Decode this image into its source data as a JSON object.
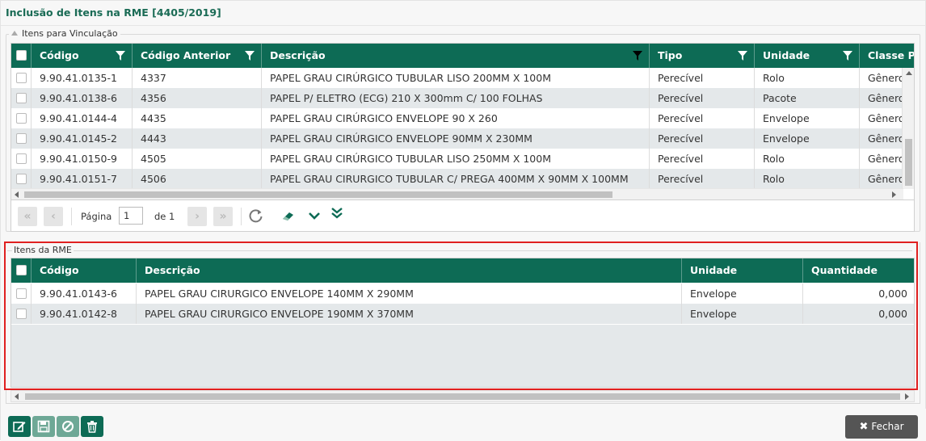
{
  "window": {
    "title": "Inclusão de Itens na RME [4405/2019]"
  },
  "vinculacao": {
    "legend": "Itens para Vinculação",
    "columns": [
      "Código",
      "Código Anterior",
      "Descrição",
      "Tipo",
      "Unidade",
      "Classe Pa"
    ],
    "rows": [
      {
        "codigo": "9.90.41.0135-1",
        "anterior": "4337",
        "descricao": "PAPEL GRAU CIRÚRGICO TUBULAR LISO 200MM X 100M",
        "tipo": "Perecível",
        "unidade": "Rolo",
        "classe": "Gênero"
      },
      {
        "codigo": "9.90.41.0138-6",
        "anterior": "4356",
        "descricao": "PAPEL P/ ELETRO (ECG) 210 X 300mm C/ 100 FOLHAS",
        "tipo": "Perecível",
        "unidade": "Pacote",
        "classe": "Gênero"
      },
      {
        "codigo": "9.90.41.0144-4",
        "anterior": "4435",
        "descricao": "PAPEL GRAU CIRÚRGICO ENVELOPE 90 X 260",
        "tipo": "Perecível",
        "unidade": "Envelope",
        "classe": "Gênero"
      },
      {
        "codigo": "9.90.41.0145-2",
        "anterior": "4443",
        "descricao": "PAPEL GRAU CIRÚRGICO ENVELOPE 90MM X 230MM",
        "tipo": "Perecível",
        "unidade": "Envelope",
        "classe": "Gênero"
      },
      {
        "codigo": "9.90.41.0150-9",
        "anterior": "4505",
        "descricao": "PAPEL GRAU CIRÚRGICO TUBULAR LISO 250MM X 100M",
        "tipo": "Perecível",
        "unidade": "Rolo",
        "classe": "Gênero"
      },
      {
        "codigo": "9.90.41.0151-7",
        "anterior": "4506",
        "descricao": "PAPEL GRAU CIRURGICO TUBULAR C/ PREGA 400MM X 90MM X 100MM",
        "tipo": "Perecível",
        "unidade": "Rolo",
        "classe": "Gênero"
      }
    ],
    "pager": {
      "page_label": "Página",
      "page_value": "1",
      "of_label": "de 1"
    }
  },
  "rme": {
    "legend": "Itens da RME",
    "columns": [
      "Código",
      "Descrição",
      "Unidade",
      "Quantidade"
    ],
    "rows": [
      {
        "codigo": "9.90.41.0143-6",
        "descricao": "PAPEL GRAU CIRURGICO ENVELOPE 140MM X 290MM",
        "unidade": "Envelope",
        "quantidade": "0,000"
      },
      {
        "codigo": "9.90.41.0142-8",
        "descricao": "PAPEL GRAU CIRURGICO ENVELOPE 190MM X 370MM",
        "unidade": "Envelope",
        "quantidade": "0,000"
      }
    ]
  },
  "actions": {
    "edit_icon": "edit-icon",
    "save_icon": "save-icon",
    "cancel_icon": "cancel-icon",
    "delete_icon": "trash-icon",
    "close_label": "Fechar"
  },
  "colors": {
    "header_green": "#0d6b55",
    "title_green": "#1a6b55",
    "highlight_red": "#e02020"
  }
}
